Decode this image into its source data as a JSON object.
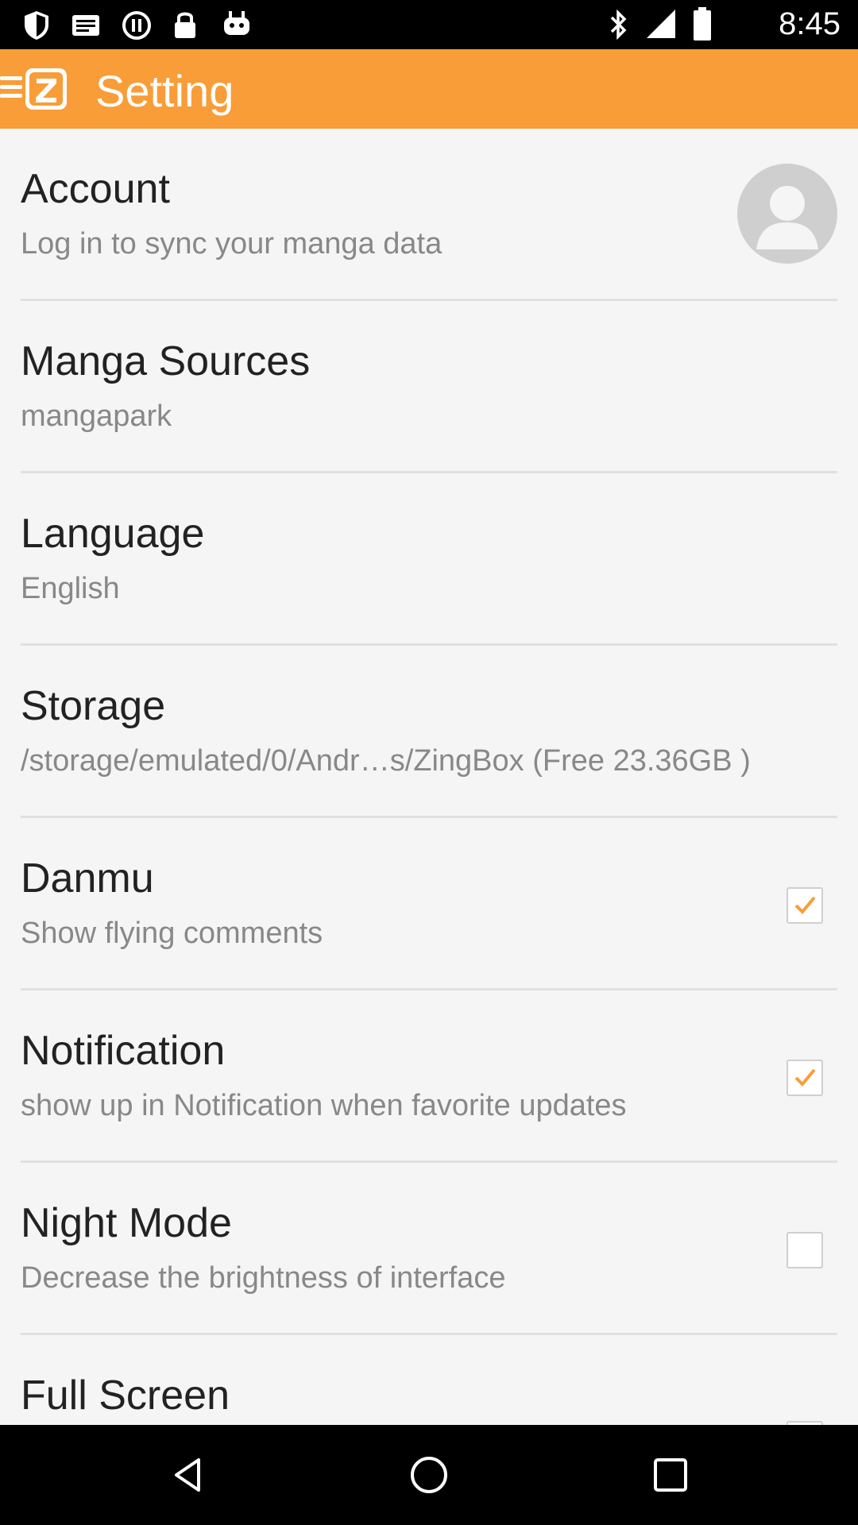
{
  "status_bar": {
    "time": "8:45",
    "left_icons": [
      "shield-icon",
      "message-icon",
      "sync-icon",
      "lock-icon",
      "android-icon"
    ],
    "right_icons": [
      "bluetooth-icon",
      "signal-icon",
      "battery-icon"
    ]
  },
  "app_bar": {
    "title": "Setting",
    "accent_color": "#f89d38"
  },
  "settings": [
    {
      "title": "Account",
      "subtitle": "Log in to sync your manga data",
      "control": "avatar"
    },
    {
      "title": "Manga Sources",
      "subtitle": "mangapark",
      "control": "none"
    },
    {
      "title": "Language",
      "subtitle": "English",
      "control": "none"
    },
    {
      "title": "Storage",
      "subtitle": "/storage/emulated/0/Andr…s/ZingBox (Free 23.36GB )",
      "control": "none"
    },
    {
      "title": "Danmu",
      "subtitle": "Show flying comments",
      "control": "checkbox",
      "checked": true
    },
    {
      "title": "Notification",
      "subtitle": "show up in Notification when favorite updates",
      "control": "checkbox",
      "checked": true
    },
    {
      "title": "Night Mode",
      "subtitle": "Decrease the brightness of interface",
      "control": "checkbox",
      "checked": false
    },
    {
      "title": "Full Screen",
      "subtitle": "",
      "control": "checkbox",
      "checked": false
    }
  ],
  "nav_bar": {
    "buttons": [
      "back-icon",
      "home-icon",
      "recents-icon"
    ]
  }
}
